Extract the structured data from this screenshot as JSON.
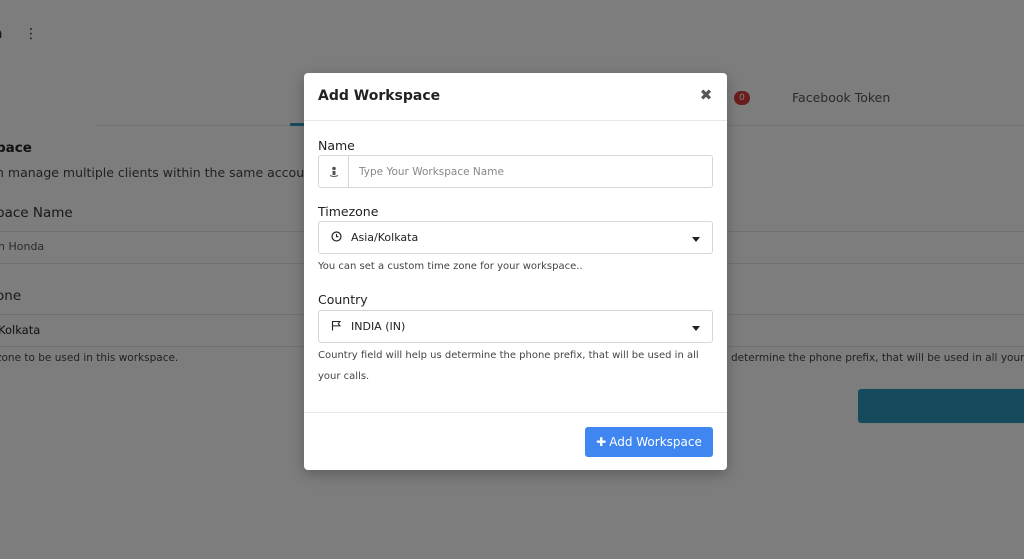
{
  "background": {
    "header_text": "a",
    "kebab_icon": "kebab-menu-icon",
    "tab_badge": "0",
    "tab_facebook": "Facebook Token",
    "section_title": "pace",
    "section_desc": "n manage multiple clients within the same account,",
    "name_label": "pace Name",
    "name_value": "n Honda",
    "timezone_label": "one",
    "timezone_value": "Kolkata",
    "timezone_help": "zone to be used in this workspace.",
    "country_help_right": "determine the phone prefix, that will be used in all your ca"
  },
  "modal": {
    "title": "Add Workspace",
    "close_icon": "close-icon",
    "name": {
      "label": "Name",
      "placeholder": "Type Your Workspace Name",
      "value": "",
      "icon": "person-icon"
    },
    "timezone": {
      "label": "Timezone",
      "selected": "Asia/Kolkata",
      "icon": "clock-icon",
      "help": "You can set a custom time zone for your workspace.."
    },
    "country": {
      "label": "Country",
      "selected": "INDIA (IN)",
      "icon": "flag-icon",
      "help": "Country field will help us determine the phone prefix, that will be used in all your calls."
    },
    "submit_label": "Add Workspace",
    "colors": {
      "primary": "#3f86f0",
      "overlay": "rgba(0,0,0,0.5)"
    }
  }
}
